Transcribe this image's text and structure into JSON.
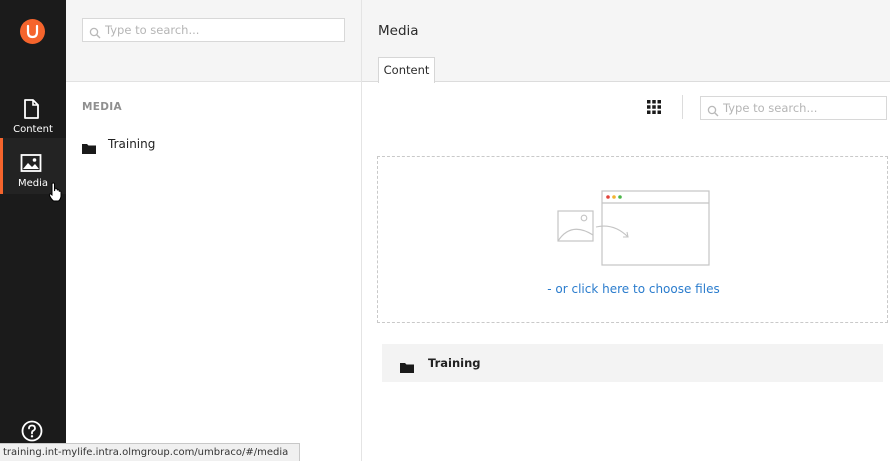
{
  "rail": {
    "logo_icon": "umbraco-logo-icon",
    "sections": [
      {
        "label": "Content",
        "icon": "document-icon",
        "active": false
      },
      {
        "label": "Media",
        "icon": "image-icon",
        "active": true
      }
    ],
    "help_icon": "help-icon"
  },
  "tree": {
    "search_placeholder": "Type to search...",
    "title": "MEDIA",
    "nodes": [
      {
        "label": "Training",
        "icon": "folder-icon"
      }
    ]
  },
  "main": {
    "title": "Media",
    "tabs": [
      {
        "label": "Content"
      }
    ],
    "search_placeholder": "Type to search...",
    "dropzone_link": "- or click here to choose files",
    "items": [
      {
        "label": "Training",
        "icon": "folder-icon"
      }
    ]
  },
  "statusbar": {
    "url": "training.int-mylife.intra.olmgroup.com/umbraco/#/media"
  },
  "colors": {
    "accent": "#f5642c",
    "rail_bg": "#1b1b1b",
    "link": "#2a7ccd"
  }
}
